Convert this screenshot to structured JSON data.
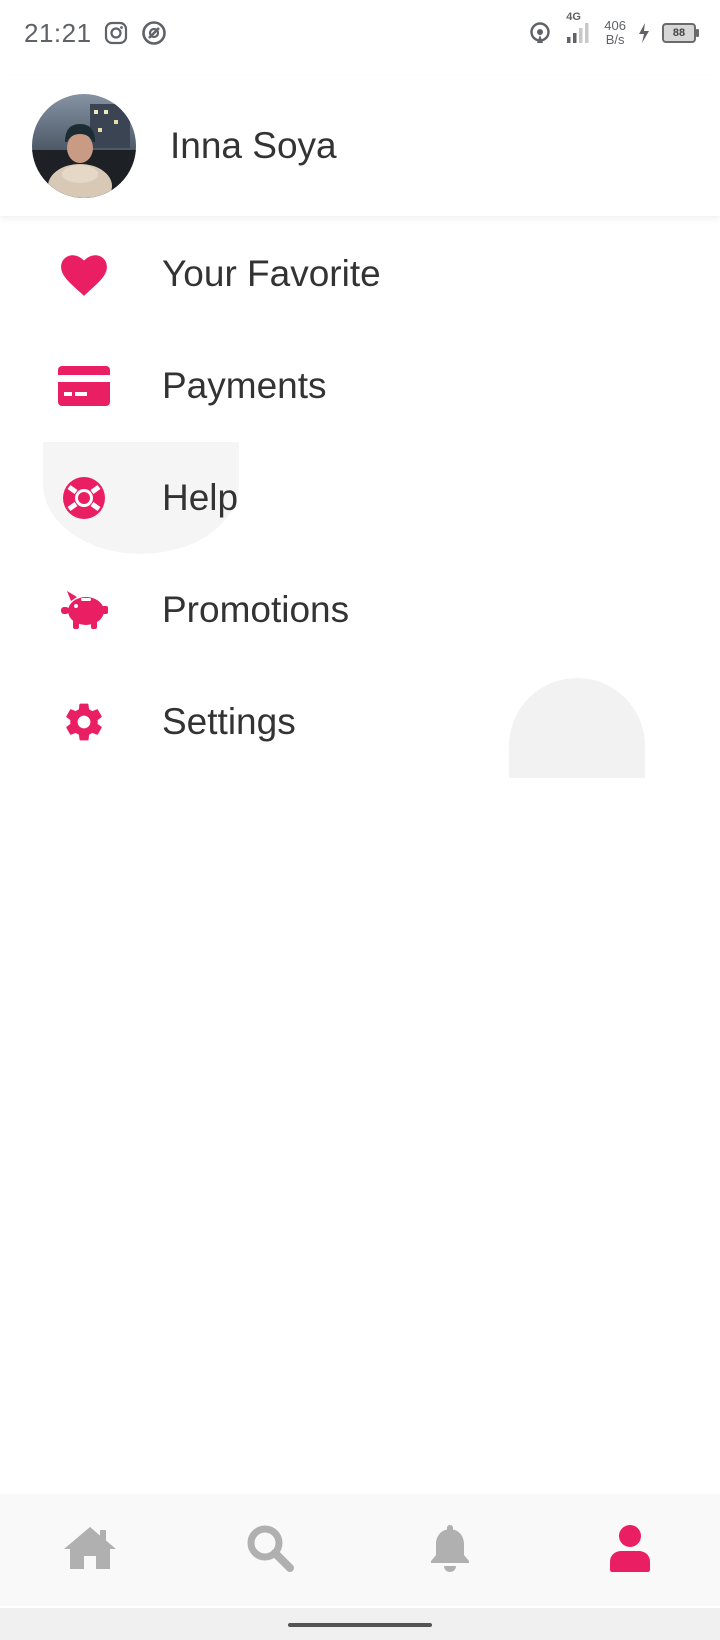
{
  "status_bar": {
    "time": "21:21",
    "net_speed_value": "406",
    "net_speed_unit": "B/s",
    "network_type": "4G",
    "battery_level": "88",
    "icons": [
      "instagram-icon",
      "vpn-icon",
      "hotspot-icon",
      "signal-icon",
      "charging-icon",
      "battery-icon"
    ]
  },
  "profile": {
    "name": "Inna Soya",
    "avatar": "avatar-photo"
  },
  "menu": {
    "items": [
      {
        "label": "Your Favorite",
        "icon": "heart-icon"
      },
      {
        "label": "Payments",
        "icon": "credit-card-icon"
      },
      {
        "label": "Help",
        "icon": "life-ring-icon"
      },
      {
        "label": "Promotions",
        "icon": "piggy-bank-icon"
      },
      {
        "label": "Settings",
        "icon": "gear-icon"
      }
    ]
  },
  "bottom_nav": {
    "items": [
      {
        "icon": "home-icon",
        "active": false
      },
      {
        "icon": "search-icon",
        "active": false
      },
      {
        "icon": "bell-icon",
        "active": false
      },
      {
        "icon": "user-icon",
        "active": true
      }
    ]
  },
  "colors": {
    "accent": "#e91e63",
    "inactive_icon": "#b0b0b0",
    "text": "#333333"
  }
}
